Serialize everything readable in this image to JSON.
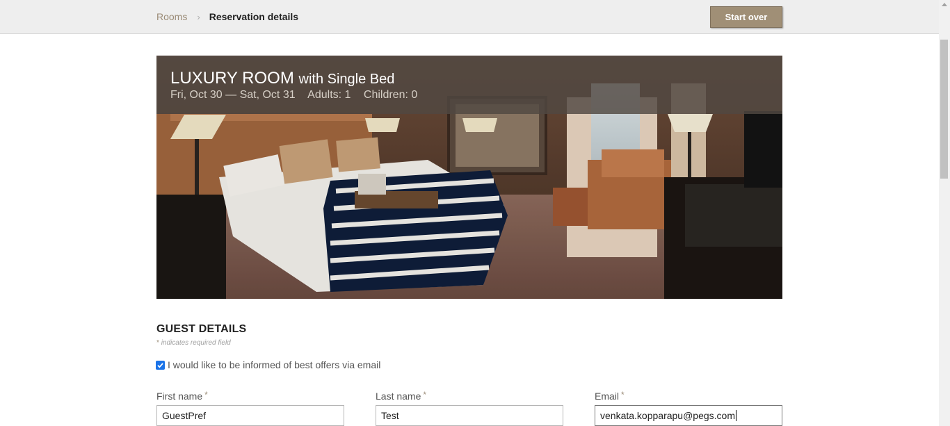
{
  "breadcrumb": {
    "rooms": "Rooms",
    "current": "Reservation details"
  },
  "header": {
    "start_over": "Start over"
  },
  "room": {
    "title_main": "LUXURY ROOM",
    "title_sub": "with Single Bed",
    "dates": "Fri, Oct 30 — Sat, Oct 31",
    "adults": "Adults: 1",
    "children": "Children: 0"
  },
  "guest": {
    "heading": "GUEST DETAILS",
    "required_star": "*",
    "required_note": "indicates required field",
    "offers_label": "I would like to be informed of best offers via email",
    "offers_checked": true,
    "fields": [
      {
        "label": "First name",
        "value": "GuestPref"
      },
      {
        "label": "Last name",
        "value": "Test"
      },
      {
        "label": "Email",
        "value": "venkata.kopparapu@pegs.com"
      }
    ]
  },
  "colors": {
    "accent": "#a08f76",
    "link": "#9a8b76",
    "checkbox": "#1a73e8",
    "overlay": "#504842"
  }
}
